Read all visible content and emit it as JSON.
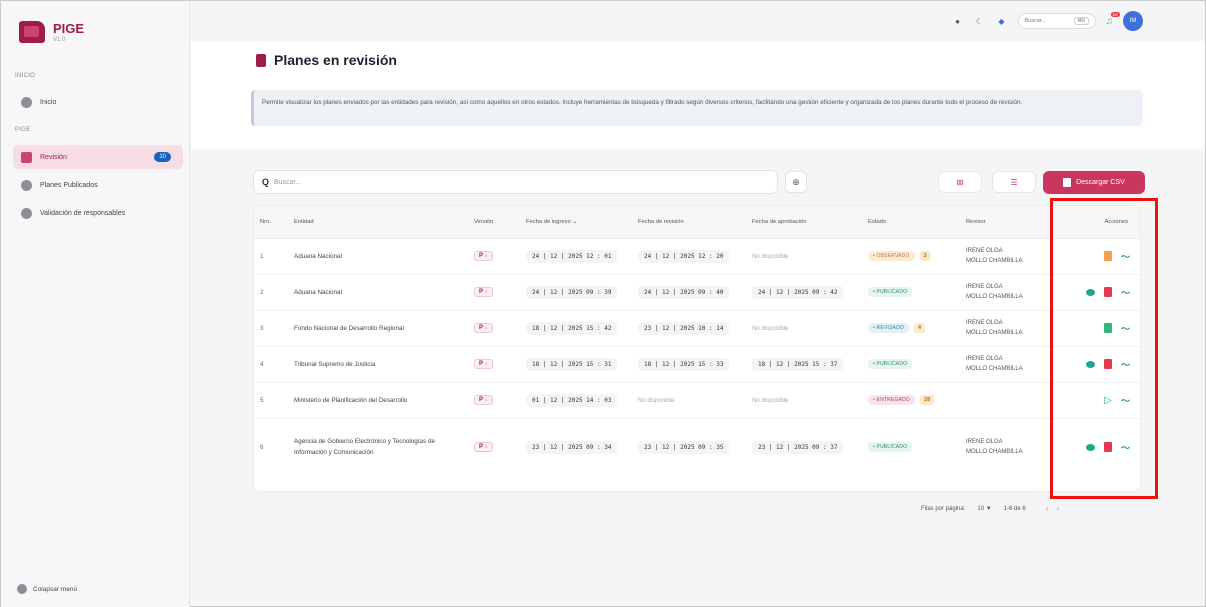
{
  "app": {
    "title": "PIGE",
    "version": "V1.0"
  },
  "sidebar": {
    "sections": [
      {
        "label": "INICIO"
      },
      {
        "label": "PIGE"
      }
    ],
    "items": [
      {
        "label": "Inicio",
        "icon": "home-icon"
      },
      {
        "label": "Revisión",
        "icon": "clipboard-icon",
        "badge": "10"
      },
      {
        "label": "Planes Publicados",
        "icon": "globe-icon"
      },
      {
        "label": "Validación de responsables",
        "icon": "user-check-icon"
      }
    ],
    "collapse_label": "Colapsar menú"
  },
  "topbar": {
    "search_placeholder": "Buscar...",
    "search_shortcut": "⌘K",
    "notifications": "10",
    "avatar_initials": "IM"
  },
  "page": {
    "title": "Planes en revisión",
    "description": "Permite visualizar los planes enviados por las entidades para revisión, así como aquellos en otros estados. Incluye herramientas de búsqueda y filtrado según diversos criterios, facilitando una gestión eficiente y organizada de los planes durante todo el proceso de revisión."
  },
  "toolbar": {
    "search_placeholder": "Buscar...",
    "csv_label": "Descargar CSV"
  },
  "table": {
    "headers": {
      "num": "Nro.",
      "entidad": "Entidad",
      "version": "Versión",
      "ingreso": "Fecha de ingreso ⌄",
      "revision": "Fecha de revisión",
      "aprobacion": "Fecha de aprobación",
      "estado": "Estado",
      "revisor": "Revisor",
      "acciones": "Acciones"
    },
    "rows": [
      {
        "num": "1",
        "entidad": "Aduana Nacional",
        "version": "P",
        "version_n": "2",
        "ingreso": "24 | 12 | 2025  12 : 01",
        "revision": "24 | 12 | 2025  12 : 20",
        "aprobacion": "No disponible",
        "estado": "• OBSERVADO",
        "estado_class": "observado",
        "count": "3",
        "revisor1": "IRENE OLGA",
        "revisor2": "MOLLO CHAMBILLA"
      },
      {
        "num": "2",
        "entidad": "Aduana Nacional",
        "version": "P",
        "version_n": "1",
        "ingreso": "24 | 12 | 2025  09 : 39",
        "revision": "24 | 12 | 2025  09 : 40",
        "aprobacion": "24 | 12 | 2025  09 : 42",
        "estado": "• PUBLICADO",
        "estado_class": "publicado",
        "count": "",
        "revisor1": "IRENE OLGA",
        "revisor2": "MOLLO CHAMBILLA"
      },
      {
        "num": "3",
        "entidad": "Fondo Nacional de Desarrollo Regional",
        "version": "P",
        "version_n": "1",
        "ingreso": "18 | 12 | 2025  15 : 42",
        "revision": "23 | 12 | 2025  10 : 14",
        "aprobacion": "No disponible",
        "estado": "• REVISADO",
        "estado_class": "revisado",
        "count": "4",
        "revisor1": "IRENE OLGA",
        "revisor2": "MOLLO CHAMBILLA"
      },
      {
        "num": "4",
        "entidad": "Tribunal Supremo de Justicia",
        "version": "P",
        "version_n": "1",
        "ingreso": "18 | 12 | 2025  15 : 31",
        "revision": "18 | 12 | 2025  15 : 33",
        "aprobacion": "18 | 12 | 2025  15 : 37",
        "estado": "• PUBLICADO",
        "estado_class": "publicado",
        "count": "",
        "revisor1": "IRENE OLGA",
        "revisor2": "MOLLO CHAMBILLA"
      },
      {
        "num": "5",
        "entidad": "Ministerio de Planificación del Desarrollo",
        "version": "P",
        "version_n": "1",
        "ingreso": "01 | 12 | 2025  14 : 03",
        "revision": "No disponible",
        "aprobacion": "No disponible",
        "estado": "• ENTREGADO",
        "estado_class": "entregado",
        "count": "28",
        "revisor1": "",
        "revisor2": ""
      },
      {
        "num": "6",
        "entidad": "Agencia de Gobierno Electrónico y Tecnologías de Información y Comunicación",
        "version": "P",
        "version_n": "1",
        "ingreso": "23 | 12 | 2025  09 : 34",
        "revision": "23 | 12 | 2025  09 : 35",
        "aprobacion": "23 | 12 | 2025  09 : 37",
        "estado": "• PUBLICADO",
        "estado_class": "publicado",
        "count": "",
        "revisor1": "IRENE OLGA",
        "revisor2": "MOLLO CHAMBILLA"
      }
    ]
  },
  "pagination": {
    "rows_label": "Filas por página:",
    "rows_value": "10 ▼",
    "range": "1-6 de 6"
  },
  "colors": {
    "brand": "#a01d4b",
    "csv_button": "#c9375f",
    "highlight": "#ee1111"
  }
}
